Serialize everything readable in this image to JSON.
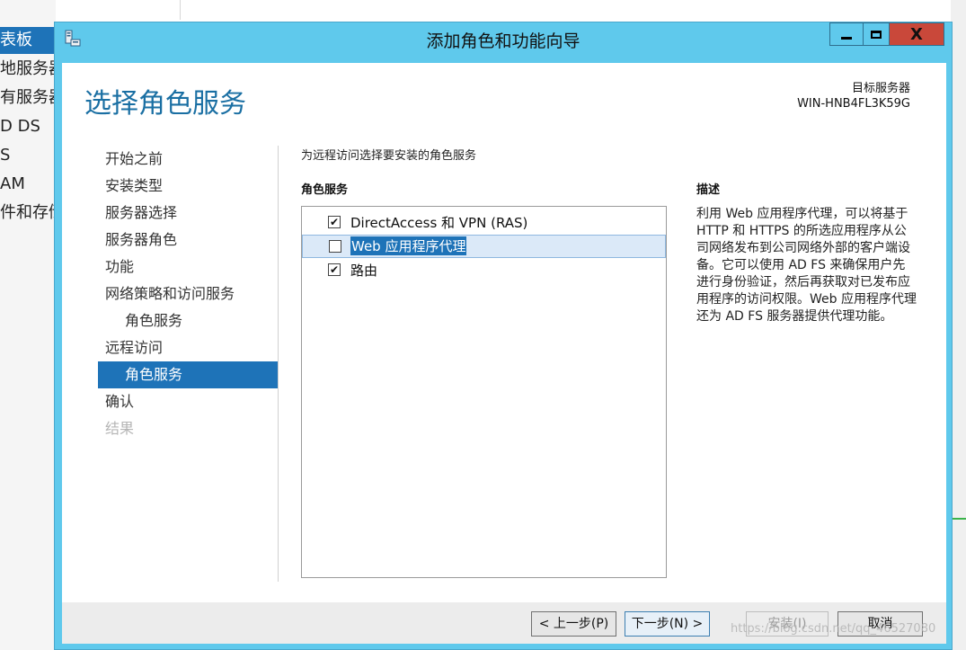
{
  "background": {
    "sidebar_items": [
      {
        "label": "表板",
        "active": true
      },
      {
        "label": "地服务器"
      },
      {
        "label": "有服务器"
      },
      {
        "label": "D DS"
      },
      {
        "label": "S"
      },
      {
        "label": "AM"
      },
      {
        "label": "件和存储"
      }
    ]
  },
  "window": {
    "title": "添加角色和功能向导",
    "controls": {
      "minimize": "—",
      "maximize": "▢",
      "close": "X"
    }
  },
  "page": {
    "title": "选择角色服务",
    "target_label": "目标服务器",
    "target_name": "WIN-HNB4FL3K59G"
  },
  "nav": [
    {
      "label": "开始之前",
      "state": "normal"
    },
    {
      "label": "安装类型",
      "state": "normal"
    },
    {
      "label": "服务器选择",
      "state": "normal"
    },
    {
      "label": "服务器角色",
      "state": "normal"
    },
    {
      "label": "功能",
      "state": "normal"
    },
    {
      "label": "网络策略和访问服务",
      "state": "normal"
    },
    {
      "label": "角色服务",
      "state": "sub"
    },
    {
      "label": "远程访问",
      "state": "normal"
    },
    {
      "label": "角色服务",
      "state": "active"
    },
    {
      "label": "确认",
      "state": "normal"
    },
    {
      "label": "结果",
      "state": "disabled"
    }
  ],
  "main": {
    "instruction": "为远程访问选择要安装的角色服务",
    "list_header": "角色服务",
    "role_services": [
      {
        "label": "DirectAccess 和 VPN (RAS)",
        "checked": true,
        "selected": false
      },
      {
        "label": "Web 应用程序代理",
        "checked": false,
        "selected": true
      },
      {
        "label": "路由",
        "checked": true,
        "selected": false
      }
    ],
    "desc_header": "描述",
    "description": "利用 Web 应用程序代理，可以将基于 HTTP 和 HTTPS 的所选应用程序从公司网络发布到公司网络外部的客户端设备。它可以使用 AD FS 来确保用户先进行身份验证，然后再获取对已发布应用程序的访问权限。Web 应用程序代理还为 AD FS 服务器提供代理功能。"
  },
  "footer": {
    "prev": "< 上一步(P)",
    "next": "下一步(N) >",
    "install": "安装(I)",
    "cancel": "取消"
  },
  "watermark": "https://blog.csdn.net/qq_46527080",
  "colors": {
    "titlebar": "#5fc9ec",
    "accent": "#1e73b8",
    "page_title": "#1a6fa3",
    "close": "#c9483a"
  }
}
